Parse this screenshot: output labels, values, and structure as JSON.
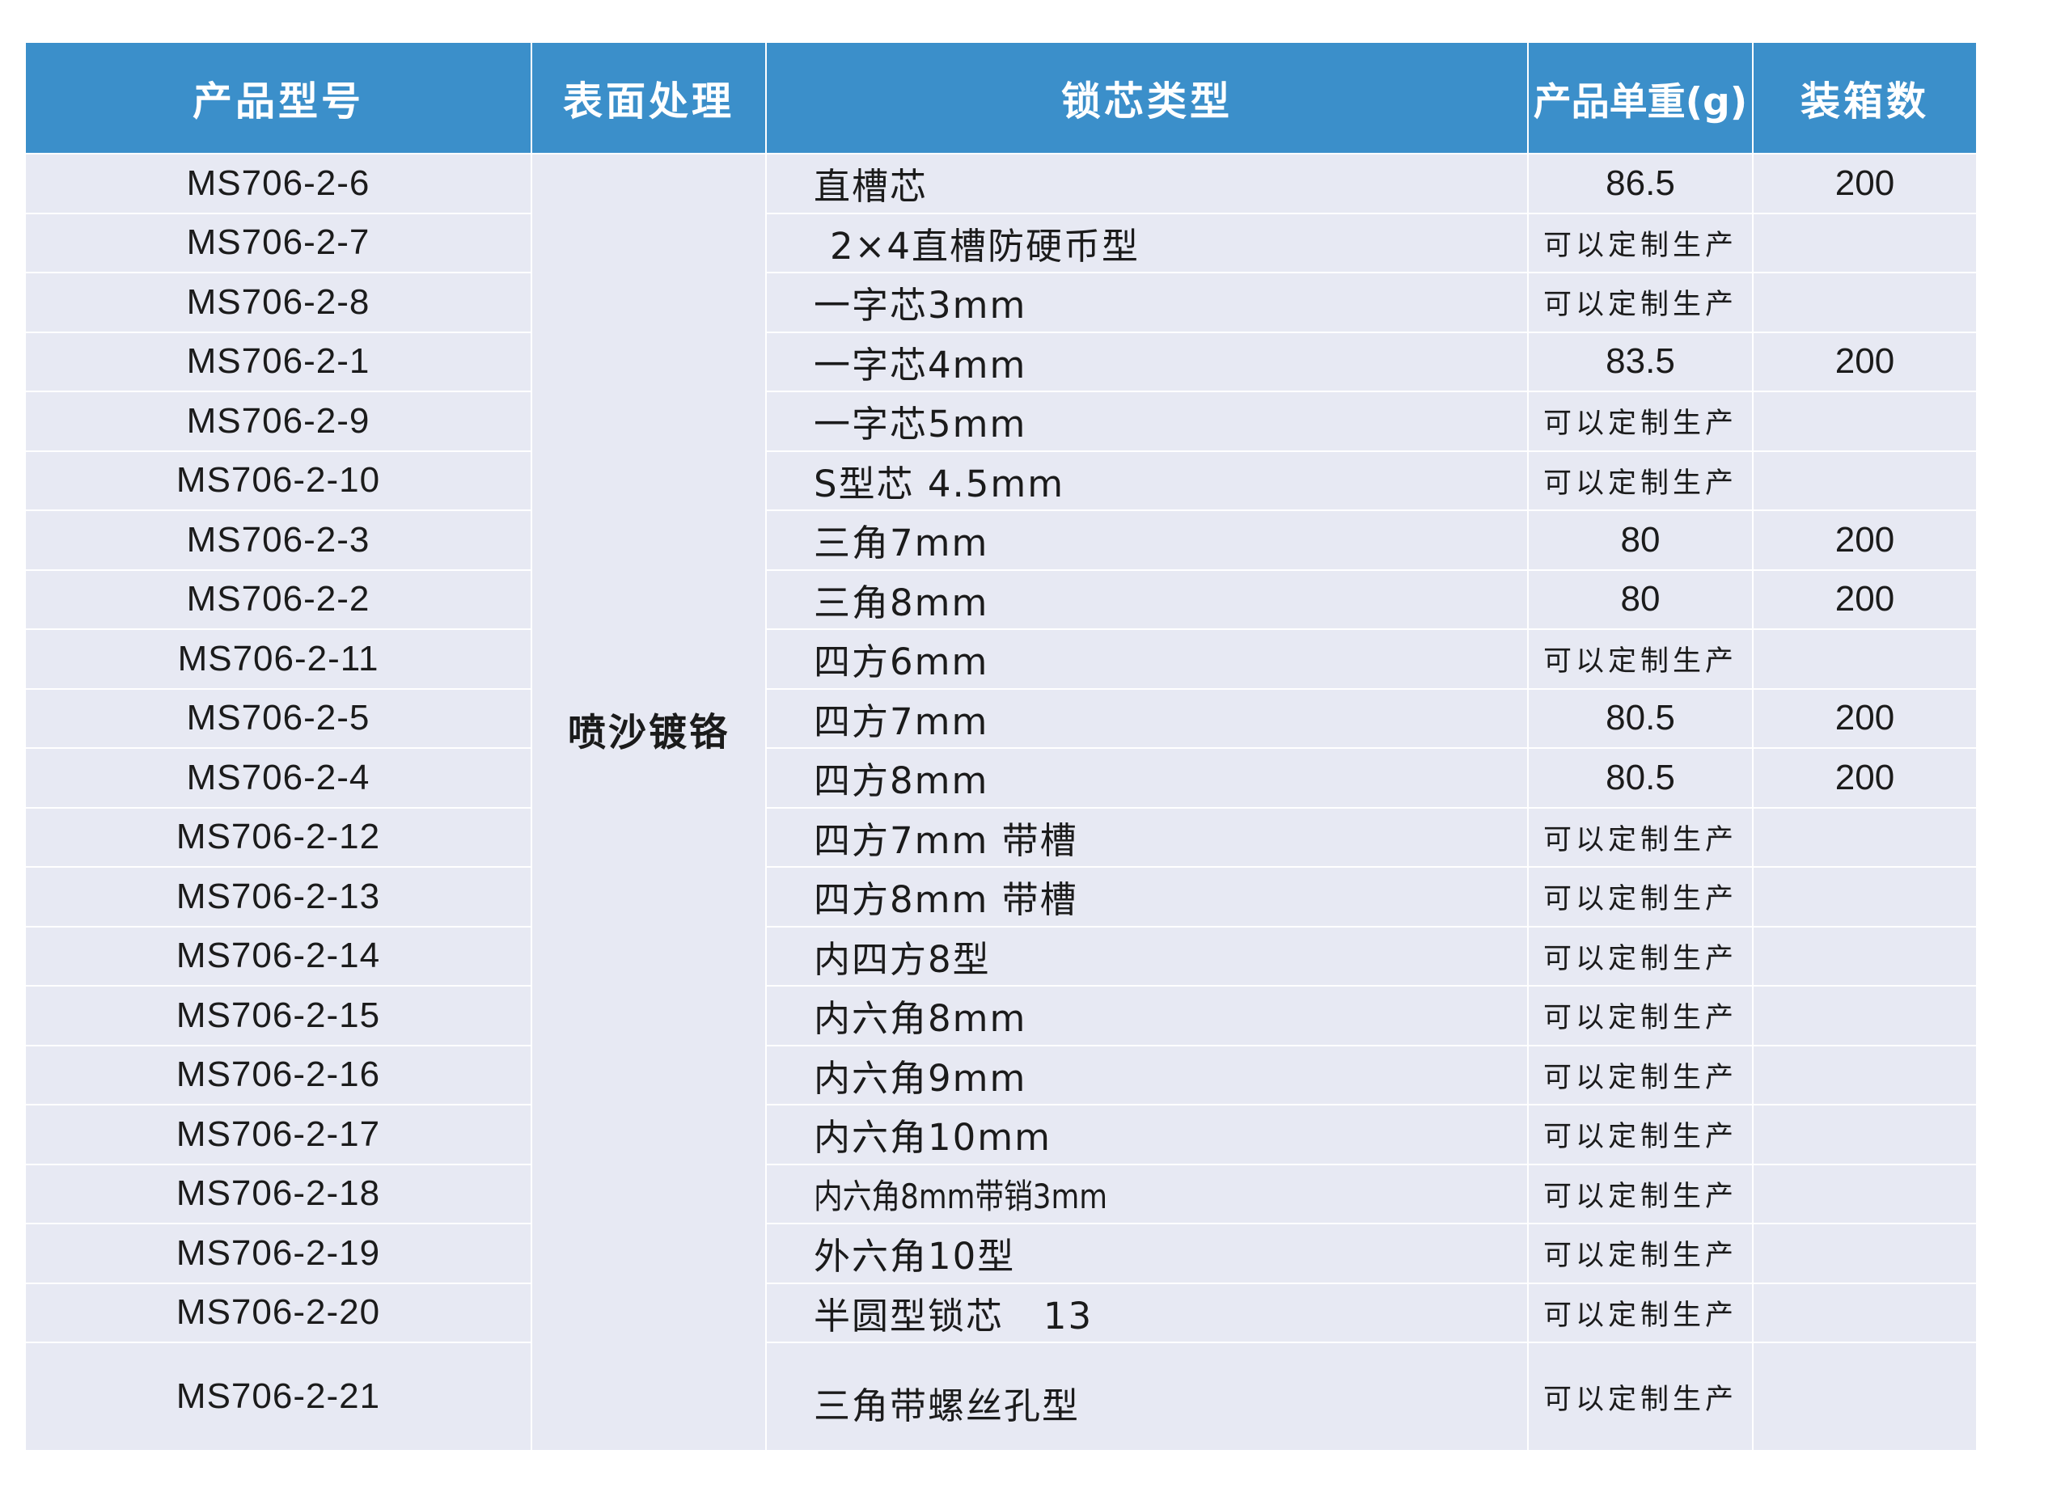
{
  "header": {
    "model": "产品型号",
    "surface": "表面处理",
    "core_type": "锁芯类型",
    "unit_weight": "产品单重(g)",
    "box_qty": "装箱数"
  },
  "surface_treatment": "喷沙镀铬",
  "rows": [
    {
      "model": "MS706-2-6",
      "core_type": "直槽芯",
      "unit_weight": "86.5",
      "box_qty": "200"
    },
    {
      "model": "MS706-2-7",
      "core_type": "2×4直槽防硬币型",
      "unit_weight": "可以定制生产",
      "box_qty": ""
    },
    {
      "model": "MS706-2-8",
      "core_type": "一字芯3mm",
      "unit_weight": "可以定制生产",
      "box_qty": ""
    },
    {
      "model": "MS706-2-1",
      "core_type": "一字芯4mm",
      "unit_weight": "83.5",
      "box_qty": "200"
    },
    {
      "model": "MS706-2-9",
      "core_type": "一字芯5mm",
      "unit_weight": "可以定制生产",
      "box_qty": ""
    },
    {
      "model": "MS706-2-10",
      "core_type": "S型芯 4.5mm",
      "unit_weight": "可以定制生产",
      "box_qty": ""
    },
    {
      "model": "MS706-2-3",
      "core_type": "三角7mm",
      "unit_weight": "80",
      "box_qty": "200"
    },
    {
      "model": "MS706-2-2",
      "core_type": "三角8mm",
      "unit_weight": "80",
      "box_qty": "200"
    },
    {
      "model": "MS706-2-11",
      "core_type": "四方6mm",
      "unit_weight": "可以定制生产",
      "box_qty": ""
    },
    {
      "model": "MS706-2-5",
      "core_type": "四方7mm",
      "unit_weight": "80.5",
      "box_qty": "200"
    },
    {
      "model": "MS706-2-4",
      "core_type": "四方8mm",
      "unit_weight": "80.5",
      "box_qty": "200"
    },
    {
      "model": "MS706-2-12",
      "core_type": "四方7mm 带槽",
      "unit_weight": "可以定制生产",
      "box_qty": ""
    },
    {
      "model": "MS706-2-13",
      "core_type": "四方8mm 带槽",
      "unit_weight": "可以定制生产",
      "box_qty": ""
    },
    {
      "model": "MS706-2-14",
      "core_type": "内四方8型",
      "unit_weight": "可以定制生产",
      "box_qty": ""
    },
    {
      "model": "MS706-2-15",
      "core_type": "内六角8mm",
      "unit_weight": "可以定制生产",
      "box_qty": ""
    },
    {
      "model": "MS706-2-16",
      "core_type": "内六角9mm",
      "unit_weight": "可以定制生产",
      "box_qty": ""
    },
    {
      "model": "MS706-2-17",
      "core_type": "内六角10mm",
      "unit_weight": "可以定制生产",
      "box_qty": ""
    },
    {
      "model": "MS706-2-18",
      "core_type": "内六角8mm带销3mm",
      "unit_weight": "可以定制生产",
      "box_qty": ""
    },
    {
      "model": "MS706-2-19",
      "core_type": "外六角10型",
      "unit_weight": "可以定制生产",
      "box_qty": ""
    },
    {
      "model": "MS706-2-20",
      "core_type": "半圆型锁芯   13",
      "unit_weight": "可以定制生产",
      "box_qty": ""
    },
    {
      "model": "MS706-2-21",
      "core_type": "三角带螺丝孔型",
      "unit_weight": "可以定制生产",
      "box_qty": ""
    }
  ],
  "colors": {
    "header_bg": "#3b8fca",
    "header_text": "#ffffff",
    "body_bg": "#e7e9f3",
    "grid_lines": "#ffffff",
    "custom_note_text": "#b8b8b8"
  }
}
